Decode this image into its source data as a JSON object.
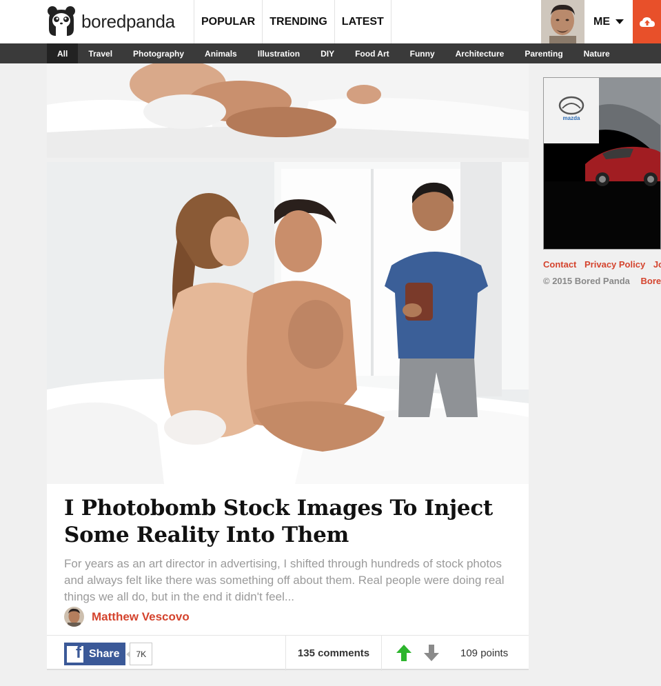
{
  "brand": {
    "name": "boredpanda"
  },
  "main_nav": [
    "POPULAR",
    "TRENDING",
    "LATEST"
  ],
  "user_menu": {
    "label": "ME"
  },
  "categories": [
    "All",
    "Travel",
    "Photography",
    "Animals",
    "Illustration",
    "DIY",
    "Food Art",
    "Funny",
    "Architecture",
    "Parenting",
    "Nature"
  ],
  "post": {
    "title": "I Photobomb Stock Images To Inject Some Reality Into Them",
    "excerpt": "For years as an art director in advertising, I shifted through hundreds of stock photos and always felt like there was something off about them. Real people were doing real things we all do, but in the end it didn't feel...",
    "author": "Matthew Vescovo",
    "share_label": "Share",
    "share_count": "7K",
    "comments": "135 comments",
    "points": "109 points"
  },
  "ad": {
    "brand_text": "mazda"
  },
  "footer_links": [
    "Contact",
    "Privacy Policy",
    "Jo"
  ],
  "copyright": "© 2015 Bored Panda",
  "copyright_link": "Bore",
  "colors": {
    "accent": "#d4432d",
    "upload": "#e8502a",
    "facebook": "#3b5998",
    "category_bar": "#3a3a3a",
    "upvote": "#2db52d"
  },
  "icons": [
    "panda-logo-icon",
    "caret-down-icon",
    "upload-cloud-icon",
    "facebook-icon",
    "upvote-arrow-icon",
    "downvote-arrow-icon"
  ]
}
